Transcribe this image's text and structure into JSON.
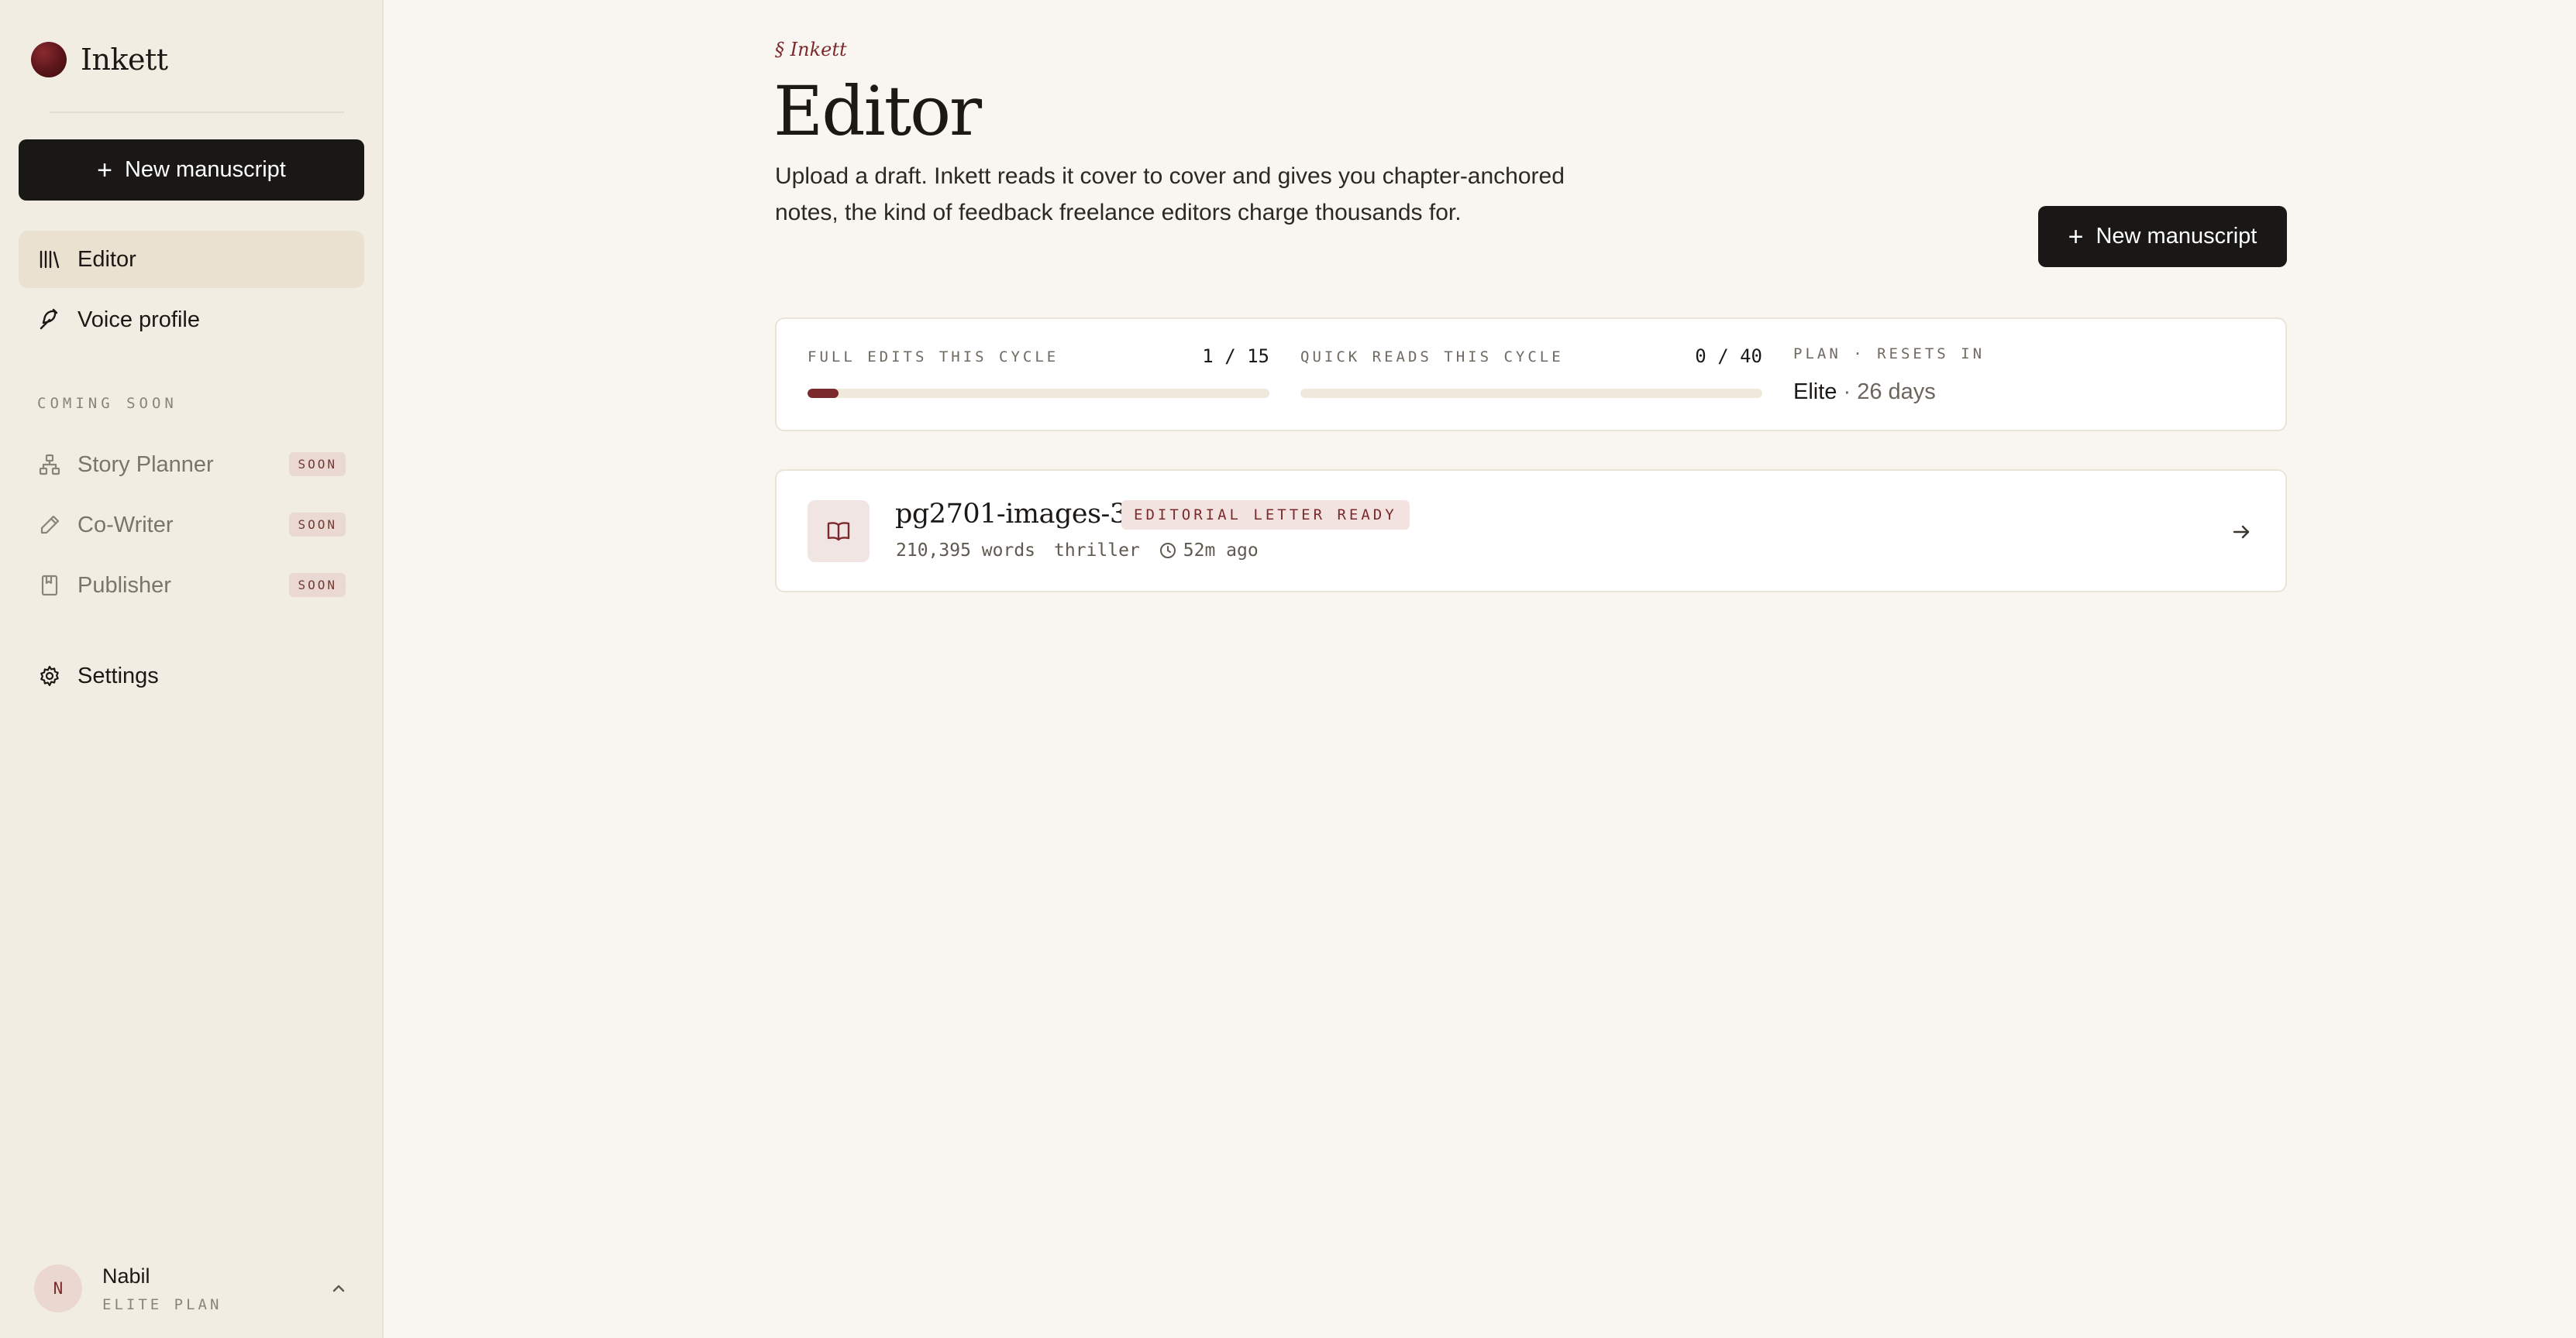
{
  "brand": {
    "name": "Inkett"
  },
  "sidebar": {
    "new_button": "New manuscript",
    "nav": [
      {
        "label": "Editor",
        "icon": "library-icon",
        "active": true
      },
      {
        "label": "Voice profile",
        "icon": "feather-icon",
        "active": false
      }
    ],
    "coming_soon_label": "COMING SOON",
    "soon_items": [
      {
        "label": "Story Planner",
        "icon": "sitemap-icon",
        "badge": "SOON"
      },
      {
        "label": "Co-Writer",
        "icon": "pencil-icon",
        "badge": "SOON"
      },
      {
        "label": "Publisher",
        "icon": "book-bookmark-icon",
        "badge": "SOON"
      }
    ],
    "settings_label": "Settings",
    "user": {
      "initial": "N",
      "name": "Nabil",
      "plan": "ELITE PLAN"
    }
  },
  "header": {
    "eyebrow": "§ Inkett",
    "title": "Editor",
    "description": "Upload a draft. Inkett reads it cover to cover and gives you chapter-anchored notes, the kind of feedback freelance editors charge thousands for.",
    "new_button": "New manuscript"
  },
  "stats": {
    "full_edits": {
      "label": "FULL EDITS THIS CYCLE",
      "count": "1 / 15",
      "used": 1,
      "total": 15
    },
    "quick_reads": {
      "label": "QUICK READS THIS CYCLE",
      "count": "0 / 40",
      "used": 0,
      "total": 40
    },
    "plan": {
      "label": "PLAN · RESETS IN",
      "name": "Elite",
      "resets": "· 26 days"
    }
  },
  "manuscripts": [
    {
      "title": "pg2701-images-3",
      "status": "EDITORIAL LETTER READY",
      "words": "210,395 words",
      "genre": "thriller",
      "updated": "52m ago"
    }
  ],
  "colors": {
    "accent": "#7a2a2c",
    "dark_button": "#1a1816",
    "sidebar_bg": "#f2ede3",
    "page_bg": "#f9f6f1"
  }
}
